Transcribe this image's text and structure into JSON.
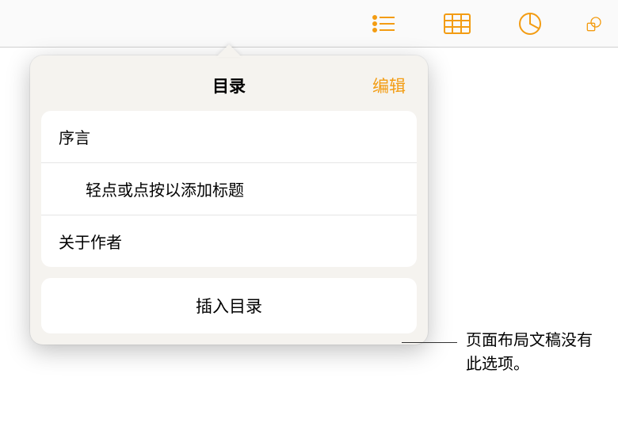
{
  "toolbar": {
    "icons": [
      "list-icon",
      "table-icon",
      "chart-icon",
      "shape-icon"
    ]
  },
  "popover": {
    "title": "目录",
    "edit_label": "编辑",
    "items": [
      {
        "label": "序言",
        "indent": false
      },
      {
        "label": "轻点或点按以添加标题",
        "indent": true
      },
      {
        "label": "关于作者",
        "indent": false
      }
    ],
    "insert_label": "插入目录"
  },
  "callout": {
    "text": "页面布局文稿没有此选项。"
  }
}
